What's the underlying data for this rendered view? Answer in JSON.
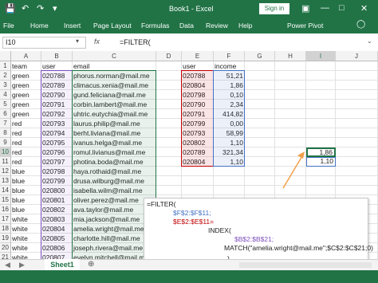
{
  "title_bar": {
    "title": "Book1 - Excel",
    "signin_label": "Sign in"
  },
  "ribbon": {
    "tabs": [
      "File",
      "Home",
      "Insert",
      "Page Layout",
      "Formulas",
      "Data",
      "Review",
      "Help",
      "Power Pivot"
    ]
  },
  "formula_bar": {
    "name_box": "I10",
    "fx": "fx",
    "content": "=FILTER("
  },
  "columns": [
    "A",
    "B",
    "C",
    "D",
    "E",
    "F",
    "G",
    "H",
    "I",
    "J"
  ],
  "rows": [
    "1",
    "2",
    "3",
    "4",
    "5",
    "6",
    "7",
    "8",
    "9",
    "10",
    "11",
    "12",
    "13",
    "14",
    "15",
    "16",
    "17",
    "18",
    "19",
    "20",
    "21"
  ],
  "table_left": {
    "headers": [
      "team",
      "user",
      "email"
    ],
    "rows": [
      [
        "green",
        "020788",
        "phorus.norman@mail.me"
      ],
      [
        "green",
        "020789",
        "climacus.xenia@mail.me"
      ],
      [
        "green",
        "020790",
        "gund.feliciana@mail.me"
      ],
      [
        "green",
        "020791",
        "corbin.lambert@mail.me"
      ],
      [
        "green",
        "020792",
        "uhtric.eutychia@mail.me"
      ],
      [
        "red",
        "020793",
        "laurus.philip@mail.me"
      ],
      [
        "red",
        "020794",
        "berht.liviana@mail.me"
      ],
      [
        "red",
        "020795",
        "ivanus.helga@mail.me"
      ],
      [
        "red",
        "020796",
        "romul.livianus@mail.me"
      ],
      [
        "red",
        "020797",
        "photina.boda@mail.me"
      ],
      [
        "blue",
        "020798",
        "haya.rothaid@mail.me"
      ],
      [
        "blue",
        "020799",
        "drusa.wilburg@mail.me"
      ],
      [
        "blue",
        "020800",
        "isabella.wilm@mail.me"
      ],
      [
        "blue",
        "020801",
        "oliver.perez@mail.me"
      ],
      [
        "blue",
        "020802",
        "ava.taylor@mail.me"
      ],
      [
        "white",
        "020803",
        "mia.jackson@mail.me"
      ],
      [
        "white",
        "020804",
        "amelia.wright@mail.me"
      ],
      [
        "white",
        "020805",
        "charlotte.hill@mail.me"
      ],
      [
        "white",
        "020806",
        "joseph.rivera@mail.me"
      ],
      [
        "white",
        "020807",
        "evelyn.mitchell@mail.me"
      ]
    ]
  },
  "table_right": {
    "headers": [
      "user",
      "income"
    ],
    "rows": [
      [
        "020788",
        "51,21"
      ],
      [
        "020804",
        "1,86"
      ],
      [
        "020798",
        "0,10"
      ],
      [
        "020790",
        "2,34"
      ],
      [
        "020791",
        "414,82"
      ],
      [
        "020799",
        "0,00"
      ],
      [
        "020793",
        "58,99"
      ],
      [
        "020802",
        "1,10"
      ],
      [
        "020789",
        "321,34"
      ],
      [
        "020804",
        "1,10"
      ]
    ]
  },
  "result_cells": [
    "1,86",
    "1,10"
  ],
  "formula_popup": {
    "lines": [
      "=FILTER(",
      "$F$2:$F$11;",
      "$E$2:$E$11=",
      "INDEX(",
      "$B$2:$B$21;",
      "MATCH(\"amelia.wright@mail.me\";$C$2:$C$21;0)",
      ")",
      ")"
    ]
  },
  "sheet_tab": "Sheet1",
  "colors": {
    "excel_green": "#217346",
    "range_purple": "#7e4fbf",
    "range_blue": "#4472c4",
    "range_red": "#c00000",
    "range_green": "#217346",
    "arrow_orange": "#f0a04b"
  }
}
